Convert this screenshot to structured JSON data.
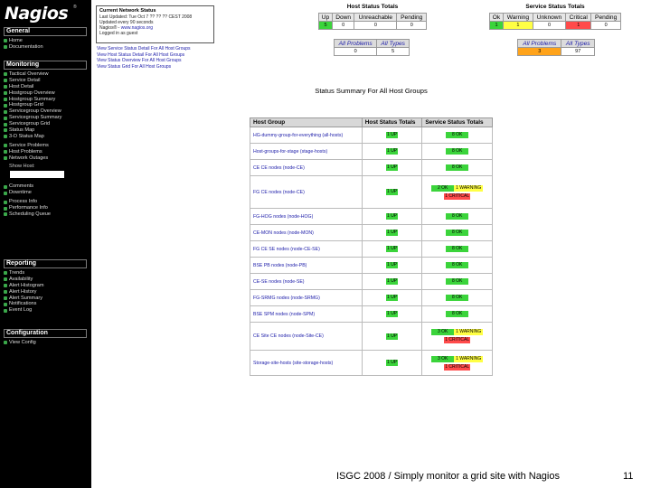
{
  "sidebar": {
    "logo": "Nagios",
    "logo_mark": "®",
    "sections": [
      {
        "title": "General",
        "items": [
          "Home",
          "Documentation"
        ]
      },
      {
        "title": "Monitoring",
        "items": [
          "Tactical Overview",
          "Service Detail",
          "Host Detail",
          "Hostgroup Overview",
          "Hostgroup Summary",
          "Hostgroup Grid",
          "Servicegroup Overview",
          "Servicegroup Summary",
          "Servicegroup Grid",
          "Status Map",
          "3-D Status Map"
        ],
        "items2": [
          "Service Problems",
          "Host Problems",
          "Network Outages"
        ],
        "show_host_label": "Show Host:",
        "items3": [
          "Comments",
          "Downtime"
        ],
        "items4": [
          "Process Info",
          "Performance Info",
          "Scheduling Queue"
        ]
      },
      {
        "title": "Reporting",
        "items": [
          "Trends",
          "Availability",
          "Alert Histogram",
          "Alert History",
          "Alert Summary",
          "Notifications",
          "Event Log"
        ]
      },
      {
        "title": "Configuration",
        "items": [
          "View Config"
        ]
      }
    ]
  },
  "status_box": {
    "title": "Current Network Status",
    "lines": [
      "Last Updated: Tue Oct 7 ?? ?? ?? CEST 2008",
      "Updated every 90 seconds",
      "Nagios® - ",
      "Logged in as guest"
    ],
    "nagios_link": "www.nagios.org"
  },
  "view_links": [
    "View Service Status Detail For All Host Groups",
    "View Host Status Detail For All Host Groups",
    "View Status Overview For All Host Groups",
    "View Status Grid For All Host Groups"
  ],
  "host_totals": {
    "title": "Host Status Totals",
    "headers": [
      "Up",
      "Down",
      "Unreachable",
      "Pending"
    ],
    "values": [
      "5",
      "0",
      "0",
      "0"
    ],
    "sub_headers": [
      "All Problems",
      "All Types"
    ],
    "sub_values": [
      "0",
      "5"
    ]
  },
  "service_totals": {
    "title": "Service Status Totals",
    "headers": [
      "Ok",
      "Warning",
      "Unknown",
      "Critical",
      "Pending"
    ],
    "values": [
      "1",
      "1",
      "0",
      "1",
      "0"
    ],
    "sub_headers": [
      "All Problems",
      "All Types"
    ],
    "sub_values": [
      "3",
      "97"
    ]
  },
  "summary": {
    "title": "Status Summary For All Host Groups",
    "headers": [
      "Host Group",
      "Host Status Totals",
      "Service Status Totals"
    ],
    "rows": [
      {
        "group": "HG-dummy-group-for-everything (all-hosts)",
        "hosts": "1 UP",
        "services": [
          "8 OK"
        ]
      },
      {
        "group": "Host-groups-for-stage (stage-hosts)",
        "hosts": "1 UP",
        "services": [
          "8 OK"
        ]
      },
      {
        "group": "CE CE nodes (node-CE)",
        "hosts": "1 UP",
        "services": [
          "8 OK"
        ]
      },
      {
        "group": "FG CE nodes (node-CE)",
        "hosts": "1 UP",
        "services": [
          "2 OK",
          "1 WARNING",
          "1 CRITICAL"
        ]
      },
      {
        "group": "FG-HOG nodes (node-HOG)",
        "hosts": "1 UP",
        "services": [
          "8 OK"
        ]
      },
      {
        "group": "CE-MON nodes (node-MON)",
        "hosts": "1 UP",
        "services": [
          "8 OK"
        ]
      },
      {
        "group": "FG CE SE nodes (node-CE-SE)",
        "hosts": "1 UP",
        "services": [
          "8 OK"
        ]
      },
      {
        "group": "BSE PB nodes (node-PB)",
        "hosts": "1 UP",
        "services": [
          "8 OK"
        ]
      },
      {
        "group": "CE-SE nodes (node-SE)",
        "hosts": "1 UP",
        "services": [
          "8 OK"
        ]
      },
      {
        "group": "FG-SRMG nodes (node-SRMG)",
        "hosts": "1 UP",
        "services": [
          "8 OK"
        ]
      },
      {
        "group": "BSE SPM nodes (node-SPM)",
        "hosts": "1 UP",
        "services": [
          "8 OK"
        ]
      },
      {
        "group": "CE Site CE nodes (node-Site-CE)",
        "hosts": "1 UP",
        "services": [
          "3 OK",
          "1 WARNING",
          "1 CRITICAL"
        ]
      },
      {
        "group": "Storage-site-hosts (site-storage-hosts)",
        "hosts": "1 UP",
        "services": [
          "3 OK",
          "1 WARNING",
          "1 CRITICAL"
        ]
      }
    ]
  },
  "footer": "ISGC 2008 / Simply monitor a grid site with Nagios",
  "page_number": "11",
  "colors": {
    "ok": "#3bd43b",
    "warning": "#ffff44",
    "critical": "#ff4b4b",
    "pending_orange": "#ffa31a"
  }
}
